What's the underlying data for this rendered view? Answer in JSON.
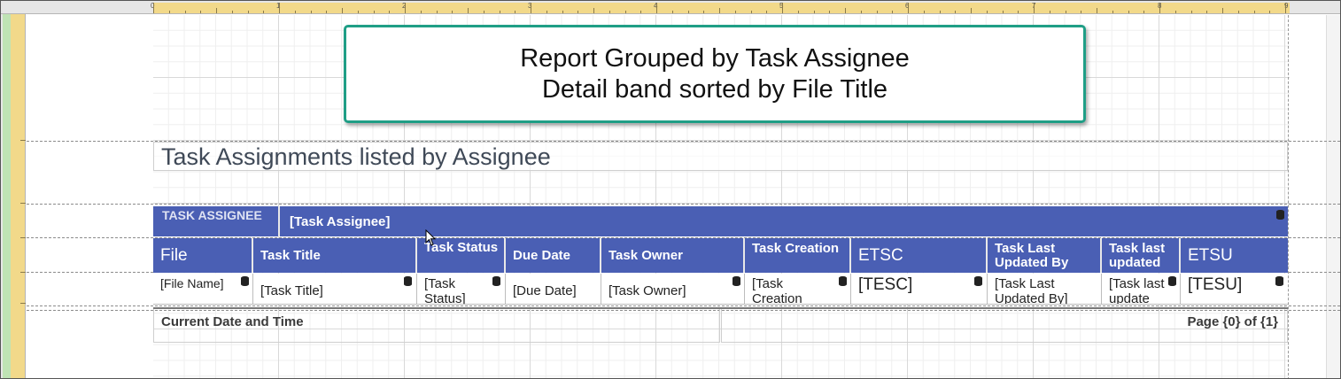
{
  "ruler": {
    "top_numbers": [
      "0",
      "1",
      "2",
      "3",
      "4",
      "5",
      "6",
      "7",
      "8",
      "9"
    ]
  },
  "callout": {
    "line1": "Report Grouped by Task Assignee",
    "line2": "Detail band sorted by File Title"
  },
  "report_title": "Task Assignments listed by Assignee",
  "group_header": {
    "label": "TASK ASSIGNEE",
    "field": "[Task Assignee]"
  },
  "columns": [
    {
      "header": "File",
      "cell": "[File Name]"
    },
    {
      "header": "Task Title",
      "cell": "[Task Title]"
    },
    {
      "header": "Task Status",
      "cell": "[Task Status]"
    },
    {
      "header": "Due Date",
      "cell": "[Due Date]"
    },
    {
      "header": "Task Owner",
      "cell": "[Task Owner]"
    },
    {
      "header": "Task Creation",
      "cell": "[Task Creation"
    },
    {
      "header": "ETSC",
      "cell": "[TESC]"
    },
    {
      "header": "Task Last Updated By",
      "cell": "[Task Last Updated By]"
    },
    {
      "header": "Task last updated",
      "cell": "[Task last update"
    },
    {
      "header": "ETSU",
      "cell": "[TESU]"
    }
  ],
  "footer": {
    "left": "Current Date and Time",
    "right": "Page {0} of {1}"
  },
  "colors": {
    "band_blue": "#4a5fb4",
    "callout_border": "#1f9e86"
  }
}
